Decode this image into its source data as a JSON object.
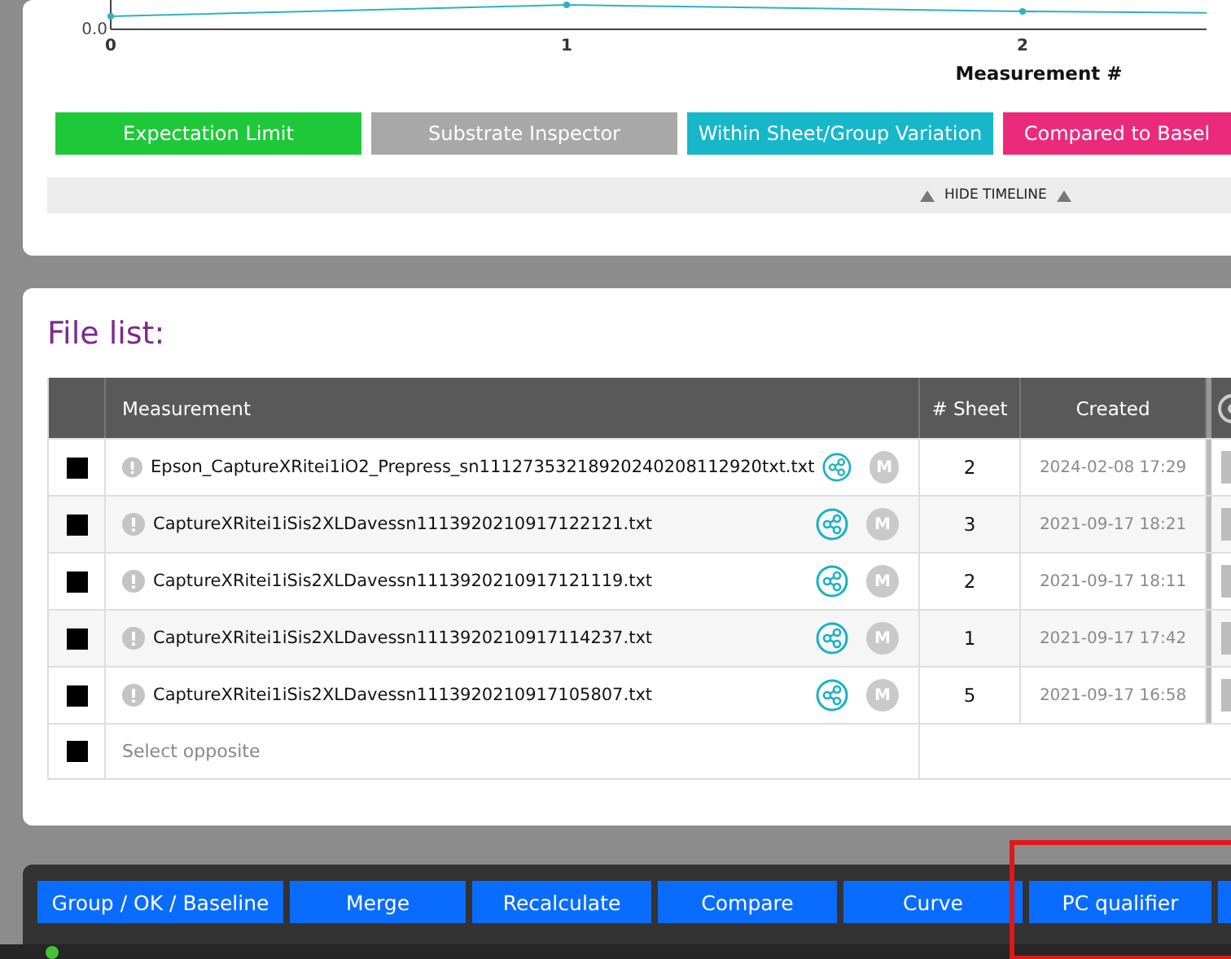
{
  "chart": {
    "y_tick": "0.0",
    "x_ticks": [
      "0",
      "1",
      "2"
    ],
    "xlabel": "Measurement #"
  },
  "legend": [
    {
      "label": "Expectation Limit",
      "color": "#1ec939"
    },
    {
      "label": "Substrate Inspector",
      "color": "#a8a8a8"
    },
    {
      "label": "Within Sheet/Group Variation",
      "color": "#17b6c9"
    },
    {
      "label": "Compared to Basel",
      "color": "#ec2a7b"
    }
  ],
  "timeline_toggle": "HIDE TIMELINE",
  "file_list": {
    "title": "File list:",
    "columns": [
      "Measurement",
      "# Sheet",
      "Created"
    ],
    "rows": [
      {
        "name": "Epson_CaptureXRitei1iO2_Prepress_sn11127353218920240208112920txt.txt",
        "sheets": "2",
        "created": "2024-02-08 17:29",
        "icon_letter": "M",
        "checked": true
      },
      {
        "name": "CaptureXRitei1iSis2XLDavessn1113920210917122121.txt",
        "sheets": "3",
        "created": "2021-09-17 18:21",
        "icon_letter": "M",
        "checked": true
      },
      {
        "name": "CaptureXRitei1iSis2XLDavessn1113920210917121119.txt",
        "sheets": "2",
        "created": "2021-09-17 18:11",
        "icon_letter": "M",
        "checked": true
      },
      {
        "name": "CaptureXRitei1iSis2XLDavessn1113920210917114237.txt",
        "sheets": "1",
        "created": "2021-09-17 17:42",
        "icon_letter": "M",
        "checked": true
      },
      {
        "name": "CaptureXRitei1iSis2XLDavessn1113920210917105807.txt",
        "sheets": "5",
        "created": "2021-09-17 16:58",
        "icon_letter": "M",
        "checked": true
      }
    ],
    "select_opposite": "Select opposite",
    "select_opposite_checked": true
  },
  "toolbar": [
    {
      "label": "Group / OK / Baseline",
      "highlighted": false
    },
    {
      "label": "Merge",
      "highlighted": false
    },
    {
      "label": "Recalculate",
      "highlighted": false
    },
    {
      "label": "Compare",
      "highlighted": false
    },
    {
      "label": "Curve",
      "highlighted": false
    },
    {
      "label": "PC qualifier",
      "highlighted": true
    }
  ]
}
